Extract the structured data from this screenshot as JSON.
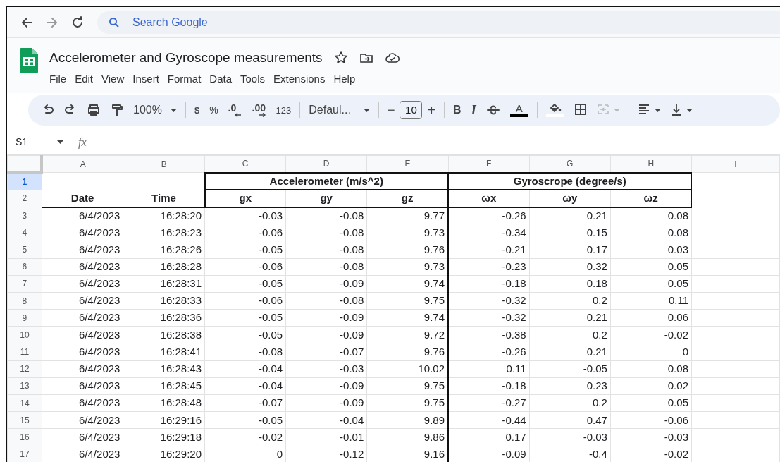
{
  "browser": {
    "search_placeholder": "Search Google"
  },
  "document": {
    "title": "Accelerometer and Gyroscope measurements"
  },
  "menu": [
    "File",
    "Edit",
    "View",
    "Insert",
    "Format",
    "Data",
    "Tools",
    "Extensions",
    "Help"
  ],
  "toolbar": {
    "zoom": "100%",
    "currency": "$",
    "percent": "%",
    "decrease_decimals": ".0",
    "increase_decimals": ".00",
    "number_format": "123",
    "font": "Defaul...",
    "font_size_minus": "−",
    "font_size": "10",
    "font_size_plus": "+",
    "bold": "B",
    "italic": "I",
    "text_color_letter": "A",
    "merge": {
      "disabled": true
    }
  },
  "formula_bar": {
    "cell": "S1",
    "function_label": "fx"
  },
  "sheet": {
    "columns": [
      "A",
      "B",
      "C",
      "D",
      "E",
      "F",
      "G",
      "H",
      "I"
    ],
    "row_numbers": [
      {
        "label": "1",
        "selected": true
      },
      {
        "label": "2",
        "selected": false
      },
      {
        "label": "3",
        "selected": false
      },
      {
        "label": "4",
        "selected": false
      },
      {
        "label": "5",
        "selected": false
      },
      {
        "label": "6",
        "selected": false
      },
      {
        "label": "7",
        "selected": false
      },
      {
        "label": "8",
        "selected": false
      },
      {
        "label": "9",
        "selected": false
      },
      {
        "label": "10",
        "selected": false
      },
      {
        "label": "11",
        "selected": false
      },
      {
        "label": "12",
        "selected": false
      },
      {
        "label": "13",
        "selected": false
      },
      {
        "label": "14",
        "selected": false
      },
      {
        "label": "15",
        "selected": false
      },
      {
        "label": "16",
        "selected": false
      },
      {
        "label": "17",
        "selected": false
      }
    ],
    "header": {
      "date": "Date",
      "time": "Time",
      "groups": [
        {
          "label": "Accelerometer (m/s^2)",
          "fields": [
            "gx",
            "gy",
            "gz"
          ]
        },
        {
          "label": "Gyroscrope (degree/s)",
          "fields": [
            "ωx",
            "ωy",
            "ωz"
          ]
        }
      ]
    },
    "rows": [
      [
        "6/4/2023",
        "16:28:20",
        "-0.03",
        "-0.08",
        "9.77",
        "-0.26",
        "0.21",
        "0.08"
      ],
      [
        "6/4/2023",
        "16:28:23",
        "-0.06",
        "-0.08",
        "9.73",
        "-0.34",
        "0.15",
        "0.08"
      ],
      [
        "6/4/2023",
        "16:28:26",
        "-0.05",
        "-0.08",
        "9.76",
        "-0.21",
        "0.17",
        "0.03"
      ],
      [
        "6/4/2023",
        "16:28:28",
        "-0.06",
        "-0.08",
        "9.73",
        "-0.23",
        "0.32",
        "0.05"
      ],
      [
        "6/4/2023",
        "16:28:31",
        "-0.05",
        "-0.09",
        "9.74",
        "-0.18",
        "0.18",
        "0.05"
      ],
      [
        "6/4/2023",
        "16:28:33",
        "-0.06",
        "-0.08",
        "9.75",
        "-0.32",
        "0.2",
        "0.11"
      ],
      [
        "6/4/2023",
        "16:28:36",
        "-0.05",
        "-0.09",
        "9.74",
        "-0.32",
        "0.21",
        "0.06"
      ],
      [
        "6/4/2023",
        "16:28:38",
        "-0.05",
        "-0.09",
        "9.72",
        "-0.38",
        "0.2",
        "-0.02"
      ],
      [
        "6/4/2023",
        "16:28:41",
        "-0.08",
        "-0.07",
        "9.76",
        "-0.26",
        "0.21",
        "0"
      ],
      [
        "6/4/2023",
        "16:28:43",
        "-0.04",
        "-0.03",
        "10.02",
        "0.11",
        "-0.05",
        "0.08"
      ],
      [
        "6/4/2023",
        "16:28:45",
        "-0.04",
        "-0.09",
        "9.75",
        "-0.18",
        "0.23",
        "0.02"
      ],
      [
        "6/4/2023",
        "16:28:48",
        "-0.07",
        "-0.09",
        "9.75",
        "-0.27",
        "0.2",
        "0.05"
      ],
      [
        "6/4/2023",
        "16:29:16",
        "-0.05",
        "-0.04",
        "9.89",
        "-0.44",
        "0.47",
        "-0.06"
      ],
      [
        "6/4/2023",
        "16:29:18",
        "-0.02",
        "-0.01",
        "9.86",
        "0.17",
        "-0.03",
        "-0.03"
      ],
      [
        "6/4/2023",
        "16:29:20",
        "0",
        "-0.12",
        "9.16",
        "-0.09",
        "-0.4",
        "-0.02"
      ]
    ]
  }
}
